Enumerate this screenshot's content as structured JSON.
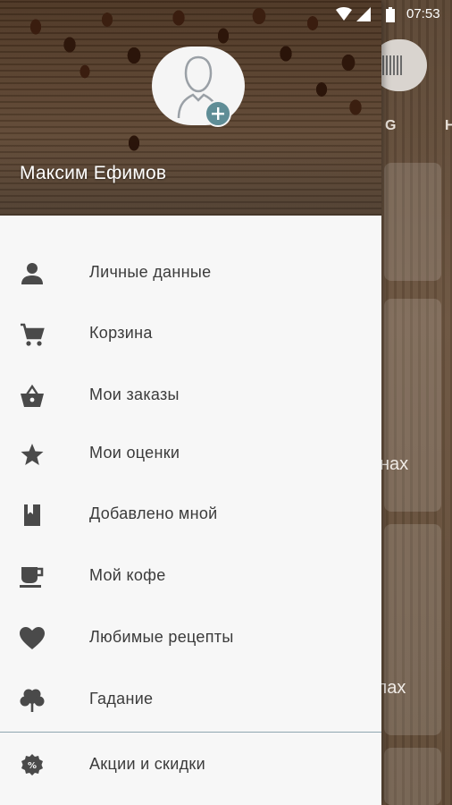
{
  "status_bar": {
    "time": "07:53"
  },
  "background_app": {
    "tab_letters": [
      "G",
      "H"
    ],
    "card_texts": [
      "нах",
      "улах"
    ]
  },
  "drawer": {
    "user_name": "Максим Ефимов",
    "menu_items": [
      {
        "label": "Личные данные",
        "icon": "person-icon"
      },
      {
        "label": "Корзина",
        "icon": "cart-icon"
      },
      {
        "label": "Мои заказы",
        "icon": "basket-icon"
      },
      {
        "label": "Мои оценки",
        "icon": "star-icon"
      },
      {
        "label": "Добавлено мной",
        "icon": "bookmark-icon"
      },
      {
        "label": "Мой кофе",
        "icon": "coffee-cup-icon"
      },
      {
        "label": "Любимые рецепты",
        "icon": "heart-icon"
      },
      {
        "label": "Гадание",
        "icon": "clover-icon"
      },
      {
        "label": "Акции и скидки",
        "icon": "discount-badge-icon"
      }
    ]
  }
}
